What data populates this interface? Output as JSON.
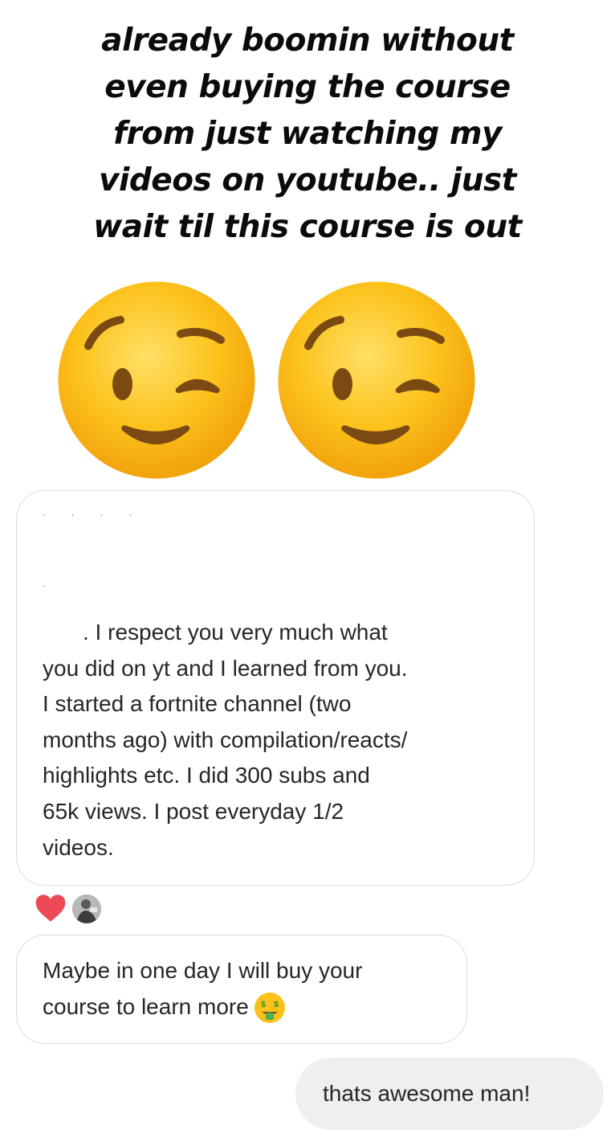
{
  "caption": {
    "lines": [
      "already boomin without",
      "even buying the course",
      "from just watching my",
      "videos on youtube.. just",
      "wait til this course is out"
    ]
  },
  "emojis": [
    "winking-face",
    "winking-face"
  ],
  "messages": [
    {
      "sender": "other",
      "lines": [
        ". I respect you very much what",
        "you did on yt and I learned from you.",
        "I started a fortnite channel (two",
        "months ago) with compilation/reacts/",
        "highlights etc. I did 300 subs and",
        "65k views. I post everyday 1/2",
        "videos."
      ]
    },
    {
      "sender": "other",
      "lines": [
        "Maybe in one day I will buy your",
        "course to learn more"
      ],
      "trailing_emoji": "money-mouth-face"
    },
    {
      "sender": "me",
      "text": "thats awesome man!"
    }
  ],
  "reaction": {
    "icon": "heart-icon",
    "color": "#ed4956"
  },
  "colors": {
    "bubble_border": "#dbdbdb",
    "sent_bubble": "#efefef",
    "text": "#262626"
  }
}
